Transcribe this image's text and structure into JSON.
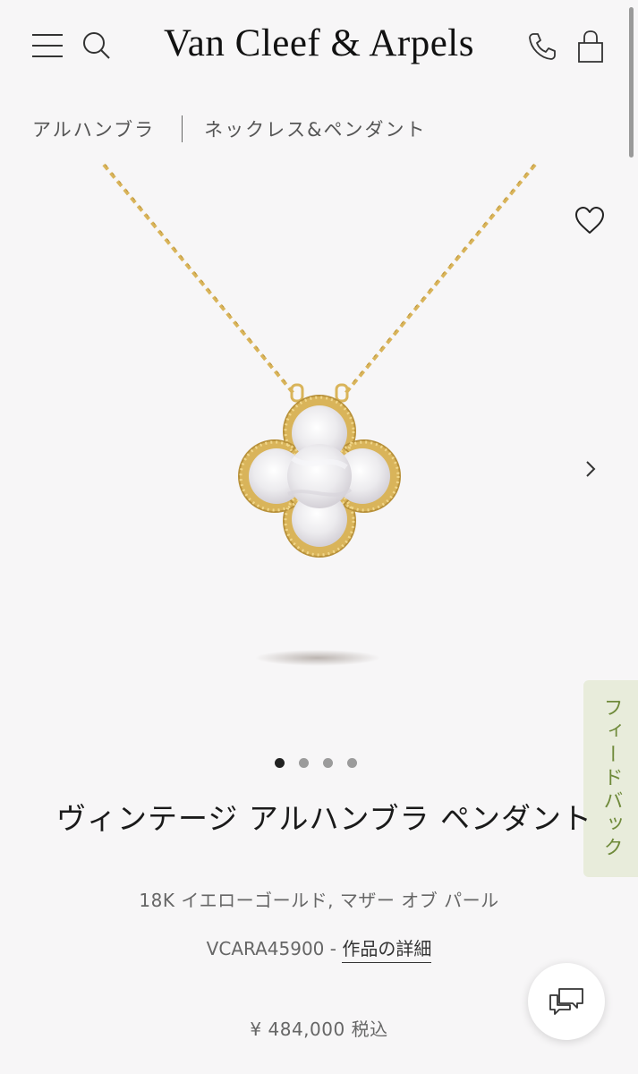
{
  "header": {
    "logo": "Van Cleef & Arpels",
    "icons": [
      "menu-icon",
      "search-icon",
      "phone-icon",
      "shopping-bag-icon"
    ]
  },
  "breadcrumb": {
    "items": [
      "アルハンブラ",
      "ネックレス&ペンダント"
    ]
  },
  "carousel": {
    "dot_count": 4,
    "active_index": 0
  },
  "feedback": {
    "label": "フィードバック"
  },
  "product": {
    "title": "ヴィンテージ アルハンブラ ペンダント",
    "material": "18K イエローゴールド, マザー オブ パール",
    "reference": "VCARA45900",
    "reference_separator": " - ",
    "details_link": "作品の詳細",
    "price": "¥ 484,000 税込"
  },
  "colors": {
    "background": "#f7f6f7",
    "gold": "#d9b45a",
    "feedback_bg": "#e8ecdb",
    "feedback_text": "#6f8a3a"
  }
}
